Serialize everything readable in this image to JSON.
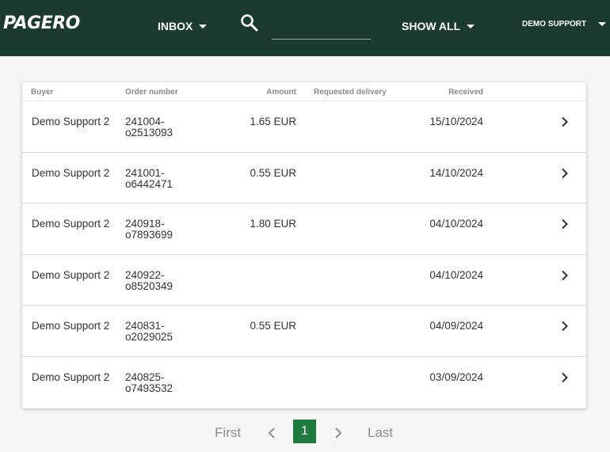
{
  "header": {
    "logo": "PAGERO",
    "inbox_label": "INBOX",
    "search_placeholder": "",
    "search_value": "",
    "filter_label": "SHOW ALL",
    "user_label": "DEMO SUPPORT"
  },
  "table": {
    "columns": {
      "buyer": "Buyer",
      "order": "Order number",
      "amount": "Amount",
      "requested": "Requested delivery",
      "received": "Received"
    },
    "rows": [
      {
        "buyer": "Demo Support 2",
        "order": "241004-o2513093",
        "amount": "1.65 EUR",
        "requested": "",
        "received": "15/10/2024"
      },
      {
        "buyer": "Demo Support 2",
        "order": "241001-o6442471",
        "amount": "0.55 EUR",
        "requested": "",
        "received": "14/10/2024"
      },
      {
        "buyer": "Demo Support 2",
        "order": "240918-o7893699",
        "amount": "1.80 EUR",
        "requested": "",
        "received": "04/10/2024"
      },
      {
        "buyer": "Demo Support 2",
        "order": "240922-o8520349",
        "amount": "",
        "requested": "",
        "received": "04/10/2024"
      },
      {
        "buyer": "Demo Support 2",
        "order": "240831-o2029025",
        "amount": "0.55 EUR",
        "requested": "",
        "received": "04/09/2024"
      },
      {
        "buyer": "Demo Support 2",
        "order": "240825-o7493532",
        "amount": "",
        "requested": "",
        "received": "03/09/2024"
      }
    ]
  },
  "pagination": {
    "first": "First",
    "current": "1",
    "last": "Last"
  },
  "colors": {
    "header_bg": "#1b3a30",
    "active_page": "#1f7a3e"
  }
}
